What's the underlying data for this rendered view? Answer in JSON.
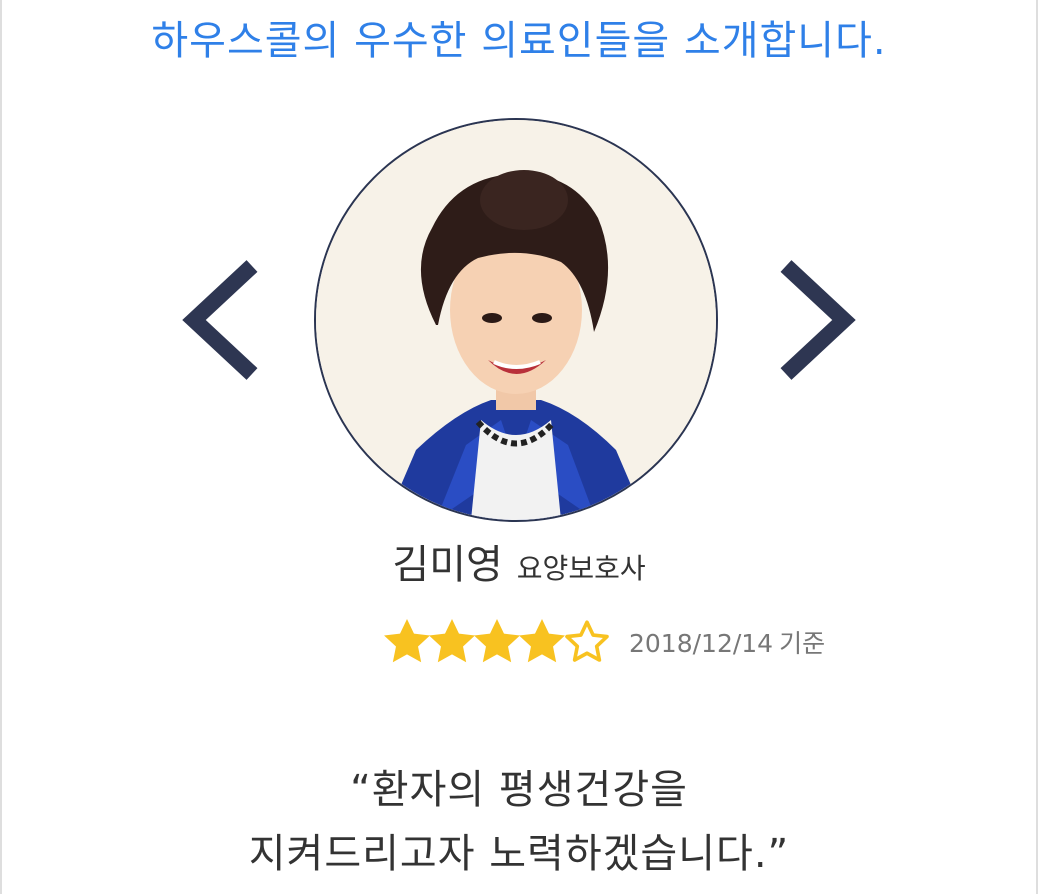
{
  "header": {
    "title": "하우스콜의 우수한 의료인들을 소개합니다."
  },
  "carousel": {
    "prev_icon": "chevron-left-icon",
    "next_icon": "chevron-right-icon",
    "arrow_color": "#2e3652"
  },
  "profile": {
    "photo": "staff-portrait-photo",
    "name": "김미영",
    "role": "요양보호사",
    "rating": {
      "value": 4,
      "max": 5,
      "star_color": "#f8c220",
      "date": "2018/12/14",
      "date_suffix": "기준"
    },
    "quote": {
      "line1": "“환자의 평생건강을",
      "line2": "지켜드리고자 노력하겠습니다.”"
    }
  },
  "colors": {
    "title": "#2f80e8",
    "text": "#333333",
    "subtext": "#777777",
    "border": "#2b3552"
  }
}
